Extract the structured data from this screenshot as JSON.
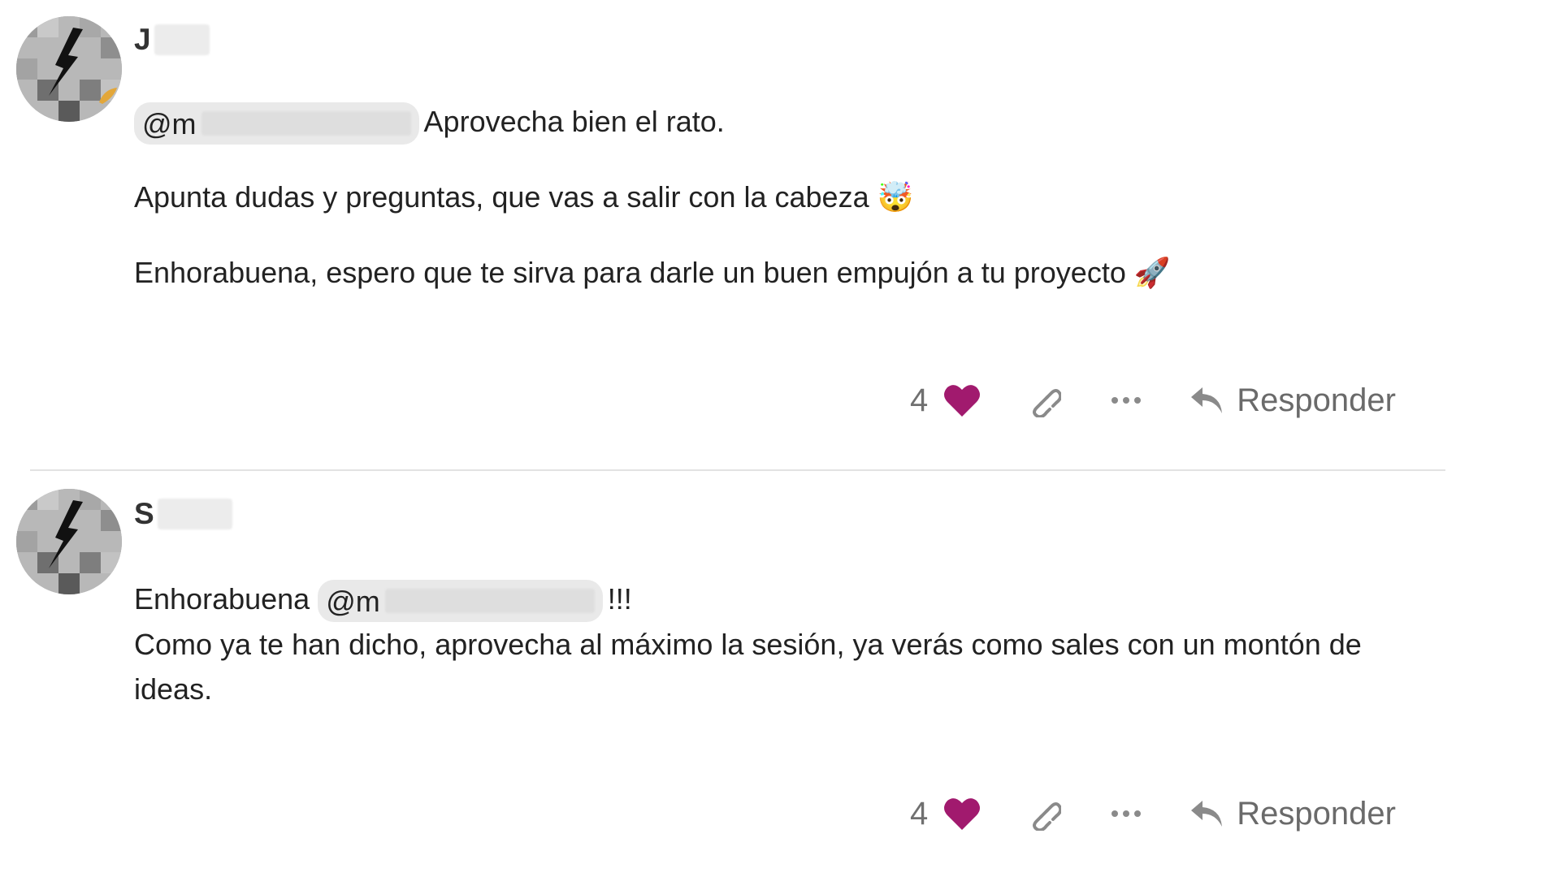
{
  "posts": [
    {
      "username_initial": "J",
      "paragraphs": [
        {
          "mention": "@m",
          "text": "Aprovecha bien el rato."
        },
        {
          "text": "Apunta dudas y preguntas, que vas a salir con la cabeza",
          "emoji": "🤯"
        },
        {
          "text": "Enhorabuena, espero que te sirva para darle un buen empujón a tu proyecto",
          "emoji": "🚀"
        }
      ],
      "likes": "4",
      "reply_label": "Responder"
    },
    {
      "username_initial": "S",
      "line1_prefix": "Enhorabuena",
      "mention": "@m",
      "line1_suffix": "!!!",
      "line2": "Como ya te han dicho, aprovecha al máximo la sesión, ya verás como sales con un montón de ideas.",
      "likes": "4",
      "reply_label": "Responder"
    }
  ],
  "icons": {
    "like": "heart-icon",
    "link": "link-icon",
    "more": "more-icon",
    "reply": "reply-icon"
  },
  "colors": {
    "heart": "#a11a6e",
    "icon_gray": "#8a8a8a",
    "mention_bg": "#e9e9e9"
  }
}
